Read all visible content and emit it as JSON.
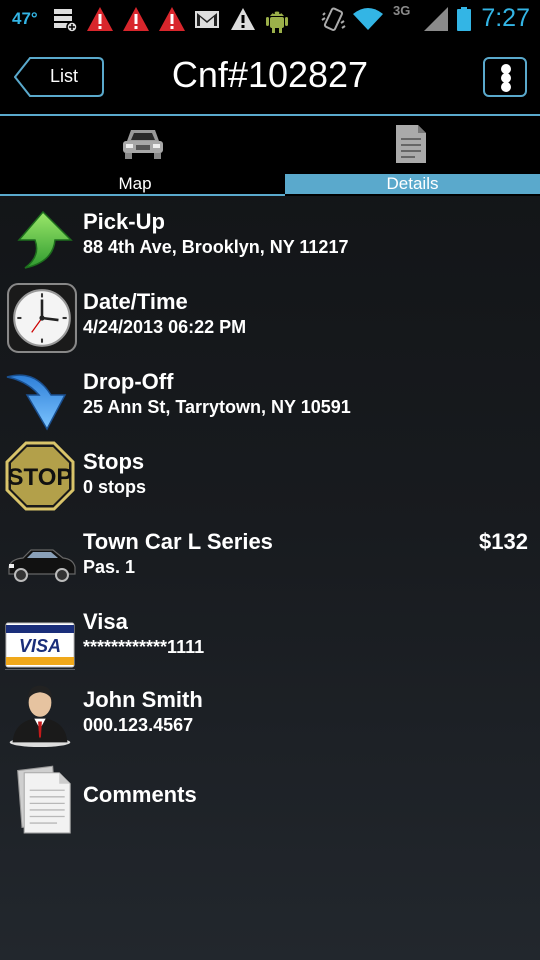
{
  "status_bar": {
    "temperature": "47°",
    "network": "3G",
    "time": "7:27",
    "icons": [
      "storage-icon",
      "alert-icon",
      "alert-icon",
      "alert-icon",
      "gmail-icon",
      "warning-icon",
      "android-icon",
      "vibrate-icon",
      "wifi-icon",
      "signal-icon",
      "battery-icon"
    ]
  },
  "header": {
    "back_label": "List",
    "title": "Cnf#102827",
    "menu_icon": "overflow-menu-icon"
  },
  "tabs": [
    {
      "label": "Map",
      "icon": "car-icon",
      "selected": false
    },
    {
      "label": "Details",
      "icon": "document-icon",
      "selected": true
    }
  ],
  "details": {
    "pickup": {
      "title": "Pick-Up",
      "subtitle": "88 4th Ave, Brooklyn, NY 11217",
      "icon": "green-up-arrow-icon"
    },
    "datetime": {
      "title": "Date/Time",
      "subtitle": "4/24/2013 06:22 PM",
      "icon": "clock-icon"
    },
    "dropoff": {
      "title": "Drop-Off",
      "subtitle": "25 Ann St, Tarrytown, NY 10591",
      "icon": "blue-down-arrow-icon"
    },
    "stops": {
      "title": "Stops",
      "subtitle": "0 stops",
      "icon": "stop-sign-icon",
      "stop_text": "STOP"
    },
    "vehicle": {
      "title": "Town Car L Series",
      "subtitle": "Pas. 1",
      "price": "$132",
      "icon": "sedan-icon"
    },
    "payment": {
      "title": "Visa",
      "subtitle": "************1111",
      "icon": "visa-card-icon",
      "card_text": "VISA"
    },
    "passenger": {
      "title": "John Smith",
      "subtitle": "000.123.4567",
      "icon": "person-icon"
    },
    "comments": {
      "title": "Comments",
      "icon": "notes-icon"
    }
  },
  "colors": {
    "accent": "#33b5e5",
    "tab_highlight": "#5aa9cc",
    "background": "#181b1f"
  }
}
